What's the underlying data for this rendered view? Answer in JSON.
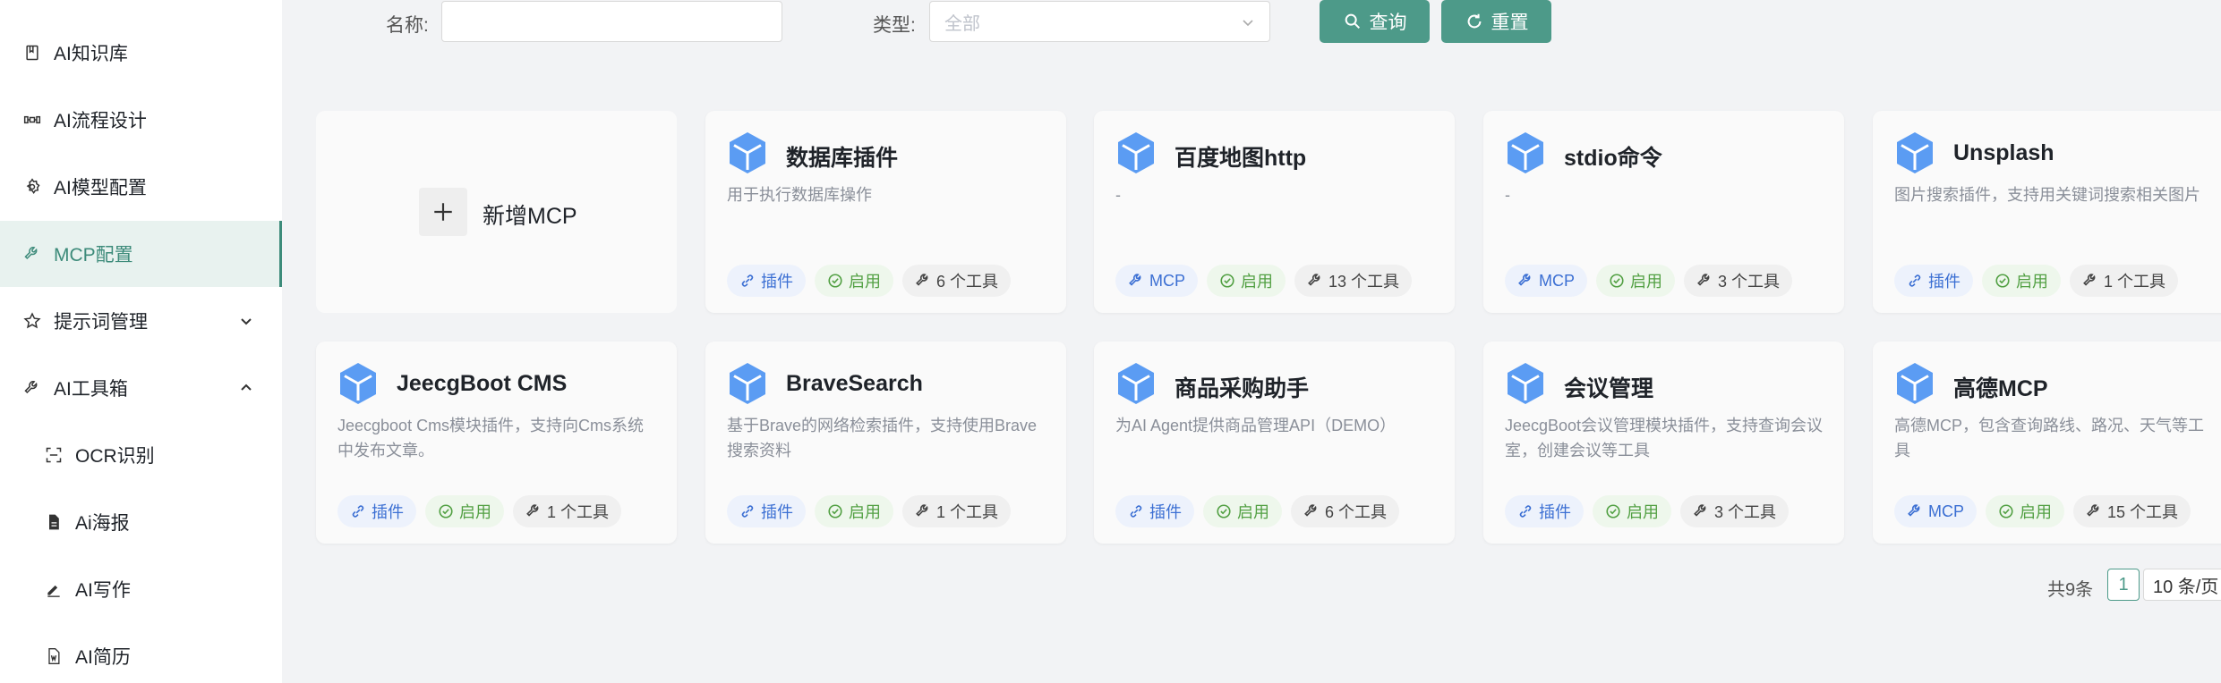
{
  "sidebar": {
    "items": [
      {
        "label": "AI知识库",
        "icon": "book-icon"
      },
      {
        "label": "AI流程设计",
        "icon": "flow-icon"
      },
      {
        "label": "AI模型配置",
        "icon": "gear-icon"
      },
      {
        "label": "MCP配置",
        "icon": "wrench-icon",
        "active": true
      },
      {
        "label": "提示词管理",
        "icon": "star-icon",
        "expandable": true
      },
      {
        "label": "AI工具箱",
        "icon": "wrench-icon",
        "expanded": true
      },
      {
        "label": "OCR识别",
        "icon": "scan-icon"
      },
      {
        "label": "Ai海报",
        "icon": "file-icon"
      },
      {
        "label": "AI写作",
        "icon": "pen-icon"
      },
      {
        "label": "AI简历",
        "icon": "word-doc-icon"
      }
    ]
  },
  "search": {
    "name_label": "名称:",
    "name_value": "",
    "type_label": "类型:",
    "type_placeholder": "全部",
    "query_label": "查询",
    "reset_label": "重置"
  },
  "add_card": {
    "label": "新增MCP"
  },
  "cards": [
    {
      "title": "数据库插件",
      "desc": "用于执行数据库操作",
      "type": "插件",
      "status": "启用",
      "tools": "6 个工具"
    },
    {
      "title": "百度地图http",
      "desc": "-",
      "type": "MCP",
      "status": "启用",
      "tools": "13 个工具"
    },
    {
      "title": "stdio命令",
      "desc": "-",
      "type": "MCP",
      "status": "启用",
      "tools": "3 个工具"
    },
    {
      "title": "Unsplash",
      "desc": "图片搜索插件，支持用关键词搜索相关图片",
      "type": "插件",
      "status": "启用",
      "tools": "1 个工具"
    },
    {
      "title": "JeecgBoot CMS",
      "desc": "Jeecgboot Cms模块插件，支持向Cms系统中发布文章。",
      "type": "插件",
      "status": "启用",
      "tools": "1 个工具"
    },
    {
      "title": "BraveSearch",
      "desc": "基于Brave的网络检索插件，支持使用Brave搜索资料",
      "type": "插件",
      "status": "启用",
      "tools": "1 个工具"
    },
    {
      "title": "商品采购助手",
      "desc": "为AI Agent提供商品管理API（DEMO）",
      "type": "插件",
      "status": "启用",
      "tools": "6 个工具"
    },
    {
      "title": "会议管理",
      "desc": "JeecgBoot会议管理模块插件，支持查询会议室，创建会议等工具",
      "type": "插件",
      "status": "启用",
      "tools": "3 个工具"
    },
    {
      "title": "高德MCP",
      "desc": "高德MCP，包含查询路线、路况、天气等工具",
      "type": "MCP",
      "status": "启用",
      "tools": "15 个工具"
    }
  ],
  "pagination": {
    "total": "共9条",
    "current_page": "1",
    "page_size": "10 条/页"
  },
  "colors": {
    "accent": "#4d9a89",
    "type_tag": "#3b6fd3",
    "status_tag": "#52a043",
    "logo_blue": "#5b9cf3"
  }
}
